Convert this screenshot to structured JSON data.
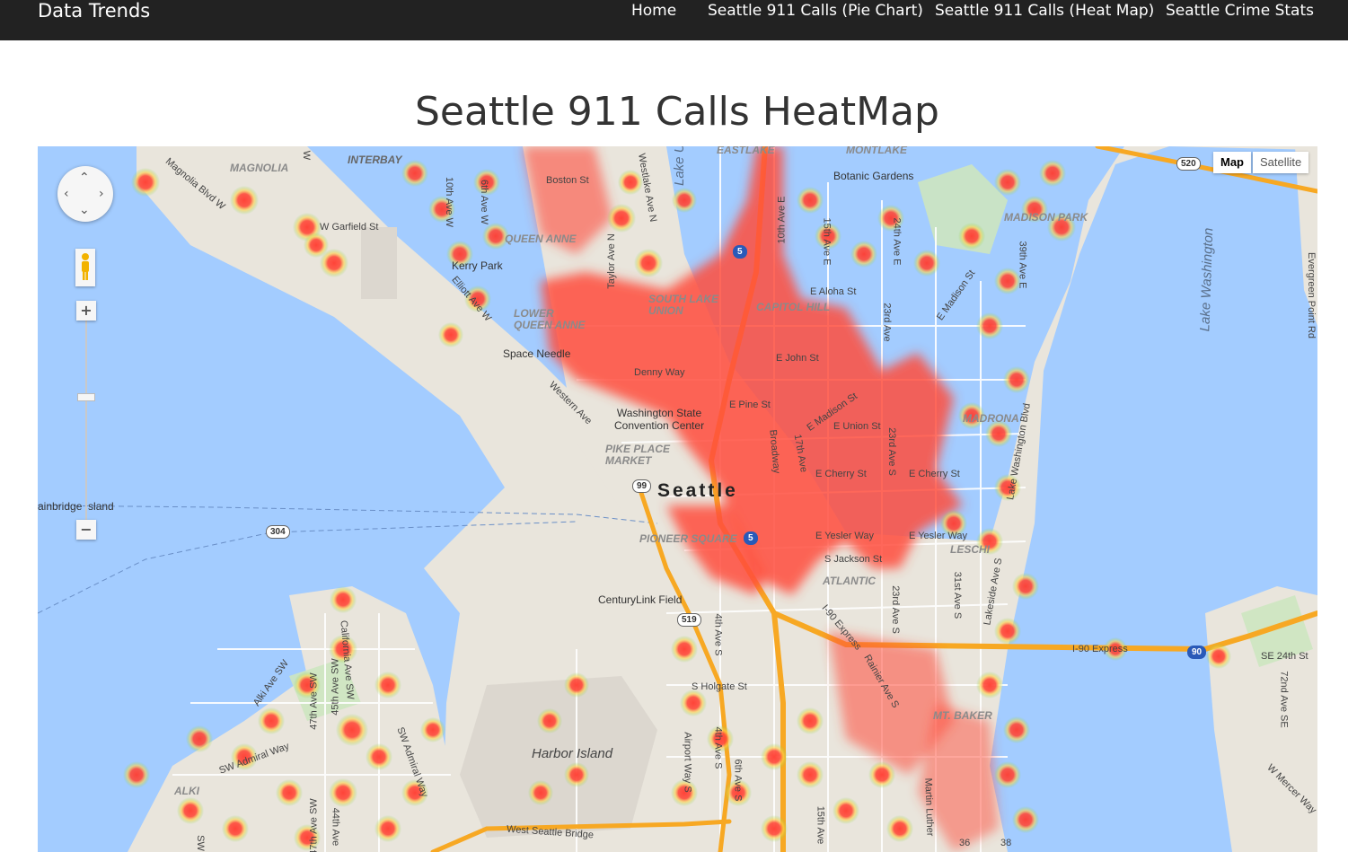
{
  "navbar": {
    "brand": "Data Trends",
    "links": [
      "Home",
      "Seattle 911 Calls (Pie Chart)",
      "Seattle 911 Calls (Heat Map)",
      "Seattle Crime Stats"
    ]
  },
  "page": {
    "title": "Seattle 911 Calls HeatMap"
  },
  "map": {
    "type_controls": {
      "map": "Map",
      "satellite": "Satellite"
    },
    "icons": {
      "pan": "pan-control-icon",
      "pegman": "street-view-pegman-icon",
      "zoom_in": "+",
      "zoom_out": "−"
    },
    "labels": {
      "city": "Seattle",
      "lake_union": "Lake U",
      "lake_washington": "Lake Washington",
      "harbor_island": "Harbor Island",
      "bainbridge": "ainbridge Island",
      "magnolia": "MAGNOLIA",
      "interbay": "INTERBAY",
      "queen_anne": "QUEEN ANNE",
      "lower_queen_anne": "LOWER\nQUEEN ANNE",
      "south_lake_union": "SOUTH LAKE\nUNION",
      "capitol_hill": "CAPITOL HILL",
      "eastlake": "EASTLAKE",
      "montlake": "MONTLAKE",
      "madison_park": "MADISON PARK",
      "madrona": "MADRONA",
      "leschi": "LESCHI",
      "atlantic": "ATLANTIC",
      "mt_baker": "MT. BAKER",
      "pike_place": "PIKE PLACE\nMARKET",
      "pioneer_square": "PIONEER SQUARE",
      "alki": "ALKI",
      "kerry_park": "Kerry Park",
      "space_needle": "Space Needle",
      "botanic_gardens": "Botanic Gardens",
      "convention_center": "Washington State\nConvention Center",
      "centurylink": "CenturyLink Field",
      "boston_st": "Boston St",
      "w_garfield_st": "W Garfield St",
      "denny_way": "Denny Way",
      "e_pine_st": "E Pine St",
      "e_john_st": "E John St",
      "e_aloha_st": "E Aloha St",
      "e_union_st": "E Union St",
      "e_cherry_st": "E Cherry St",
      "e_cherry_st2": "E Cherry St",
      "e_yesler_way": "E Yesler Way",
      "e_yesler_way2": "E Yesler Way",
      "s_jackson_st": "S Jackson St",
      "s_holgate_st": "S Holgate St",
      "e_madison_st": "E Madison St",
      "e_madison_st2": "E Madison St",
      "broadway": "Broadway",
      "i90_express": "I-90 Express",
      "i90_express2": "I-90 Express",
      "west_seattle_bridge": "West Seattle Bridge",
      "se_24th_st": "SE 24th St",
      "w_mercer_way": "W Mercer Way",
      "sw_admiral_way": "SW Admiral Way",
      "sw_admiral_way2": "SW Admiral Way",
      "alki_ave": "Alki Ave SW",
      "california_ave": "California Ave SW",
      "magnolia_blvd": "Magnolia Blvd W",
      "elliott_ave": "Elliott Ave W",
      "western_ave": "Western Ave",
      "lake_washington_blvd": "Lake Washington Blvd",
      "lakeside_ave": "Lakeside Ave S",
      "evergreen_point_rd": "Evergreen Point Rd",
      "rainier_ave": "Rainier Ave S",
      "martin_luther": "Martin Luther",
      "airport_way": "Airport Way S",
      "st_10th_ave_w": "10th Ave W",
      "st_6th_ave_w": "6th Ave W",
      "st_taylor_ave": "Taylor Ave N",
      "st_westlake": "Westlake Ave N",
      "st_10th_ave_e": "10th Ave E",
      "st_15th_ave_e": "15th Ave E",
      "st_24th_ave_e": "24th Ave E",
      "st_39th_ave_e": "39th Ave E",
      "st_17th_ave": "17th Ave",
      "st_23rd_ave": "23rd Ave",
      "st_23rd_ave_s": "23rd Ave S",
      "st_23rd_ave_s2": "23rd Ave S",
      "st_31st_ave_s": "31st Ave S",
      "st_4th_ave_s": "4th Ave S",
      "st_4th_ave_s2": "4th Ave S",
      "st_6th_ave_s": "6th Ave S",
      "st_15th_ave": "15th Ave",
      "st_72nd_ave_se": "72nd Ave SE",
      "st_47th_ave_sw": "47th Ave SW",
      "st_45th_ave_sw": "45th Ave SW",
      "st_47th_ave_sw2": "47th Ave SW",
      "st_44th_ave": "44th Ave",
      "st_36th": "36",
      "st_38th": "38",
      "st_w": "W",
      "st_sw": "SW",
      "route_520": "520",
      "route_5": "5",
      "route_5b": "5",
      "route_99": "99",
      "route_304": "304",
      "route_519": "519",
      "route_90": "90"
    }
  }
}
